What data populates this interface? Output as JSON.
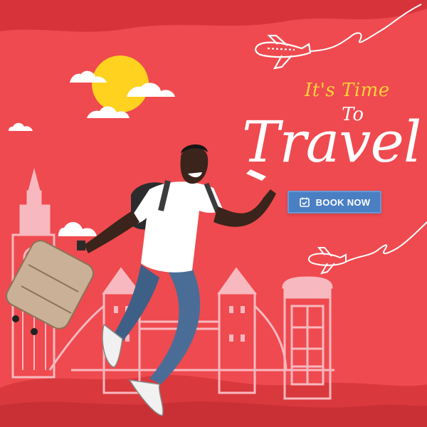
{
  "banner": {
    "eyebrow": "It's Time",
    "connector": "To",
    "headline": "Travel",
    "cta_label": "BOOK NOW"
  },
  "icons": {
    "cta": "calendar-check-icon",
    "planes": [
      "airplane-icon",
      "airplane-icon"
    ],
    "scenery": [
      "sun-icon",
      "cloud-icon",
      "big-ben-icon",
      "tower-bridge-icon",
      "phone-booth-icon",
      "suitcase-icon",
      "traveler-figure"
    ]
  },
  "colors": {
    "background": "#ef4a4f",
    "wave": "#d9383d",
    "sun": "#ffd21f",
    "eyebrow_text": "#ffd23a",
    "headline_text": "#ffffff",
    "cta_background": "#4a7fc4",
    "landmark": "#f7b9bf"
  }
}
